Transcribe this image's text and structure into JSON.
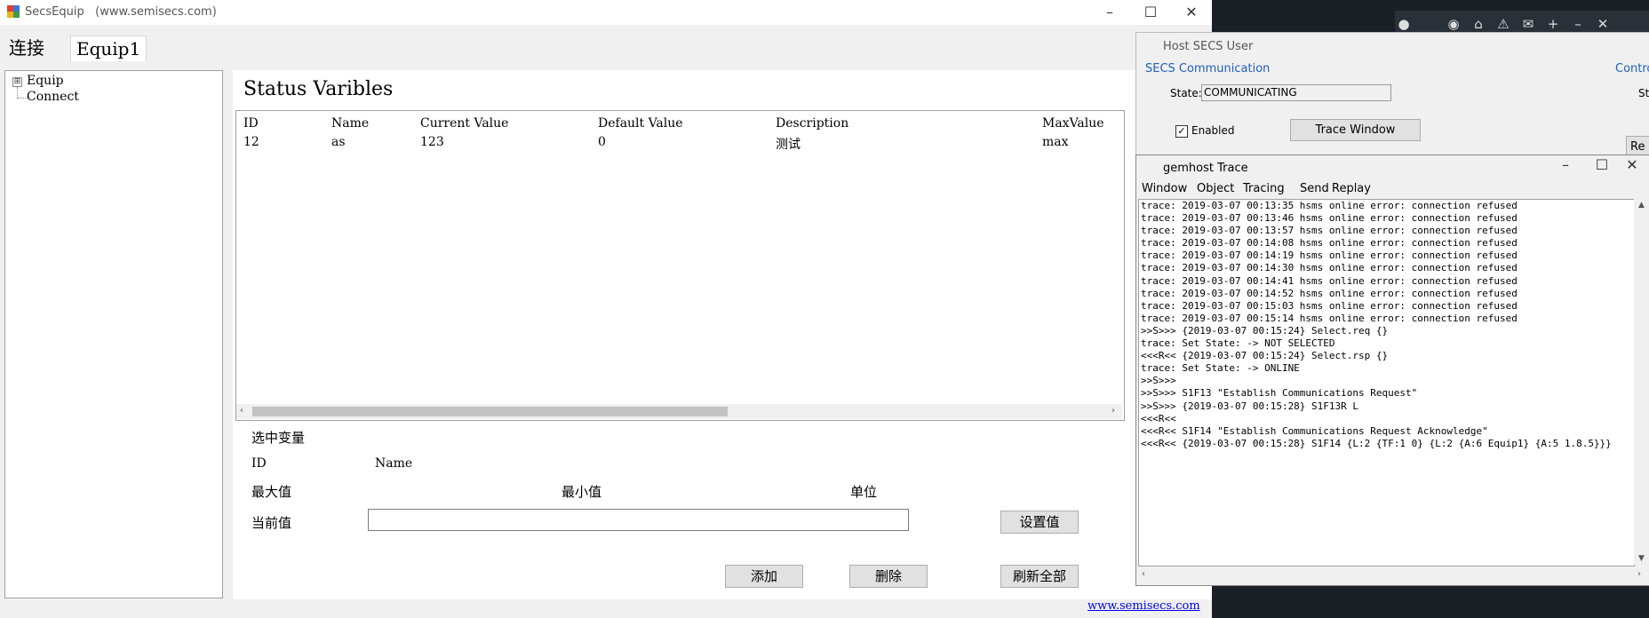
{
  "main_window": {
    "app_title": "SecsEquip",
    "website_title": "(www.semisecs.com)",
    "tabs": [
      {
        "label": "连接"
      },
      {
        "label": "Equip1"
      }
    ],
    "tree": [
      {
        "label": "Equip",
        "expander": "⊞"
      },
      {
        "label": "Connect"
      }
    ],
    "section_title": "Status Varibles",
    "grid": {
      "columns": [
        "ID",
        "Name",
        "Current Value",
        "Default Value",
        "Description",
        "MaxValue"
      ],
      "rows": [
        [
          "12",
          "as",
          "123",
          "0",
          "测试",
          "max"
        ]
      ]
    },
    "selected": {
      "heading": "选中变量",
      "id_label": "ID",
      "name_label": "Name",
      "max_label": "最大值",
      "min_label": "最小值",
      "unit_label": "单位",
      "current_label": "当前值",
      "current_value": ""
    },
    "buttons": {
      "set_value": "设置值",
      "add": "添加",
      "delete": "删除",
      "refresh_all": "刷新全部"
    },
    "footer_link": "www.semisecs.com"
  },
  "host_window": {
    "title": "Host SECS User",
    "group_communication": "SECS Communication",
    "group_control": "Contro",
    "state_label": "State:",
    "state_value": "COMMUNICATING",
    "enabled_label": "Enabled",
    "enabled_checked": "✓",
    "trace_button": "Trace Window",
    "partial_right_label": "St",
    "partial_button": "Re"
  },
  "trace_window": {
    "title": "gemhost Trace",
    "menu": [
      "Window",
      "Object",
      "Tracing",
      "Send",
      "Replay"
    ],
    "log_lines": [
      "trace: 2019-03-07 00:13:35 hsms online error: connection refused",
      "trace: 2019-03-07 00:13:46 hsms online error: connection refused",
      "trace: 2019-03-07 00:13:57 hsms online error: connection refused",
      "trace: 2019-03-07 00:14:08 hsms online error: connection refused",
      "trace: 2019-03-07 00:14:19 hsms online error: connection refused",
      "trace: 2019-03-07 00:14:30 hsms online error: connection refused",
      "trace: 2019-03-07 00:14:41 hsms online error: connection refused",
      "trace: 2019-03-07 00:14:52 hsms online error: connection refused",
      "trace: 2019-03-07 00:15:03 hsms online error: connection refused",
      "trace: 2019-03-07 00:15:14 hsms online error: connection refused",
      ">>S>>> {2019-03-07 00:15:24} Select.req {}",
      "trace: Set State: -> NOT SELECTED",
      "<<<R<< {2019-03-07 00:15:24} Select.rsp {}",
      "trace: Set State: -> ONLINE",
      ">>S>>>",
      ">>S>>> S1F13 \"Establish Communications Request\"",
      ">>S>>> {2019-03-07 00:15:28} S1F13R L",
      "<<<R<<",
      "<<<R<< S1F14 \"Establish Communications Request Acknowledge\"",
      "<<<R<< {2019-03-07 00:15:28} S1F14 {L:2 {TF:1 0} {L:2 {A:6 Equip1} {A:5 1.8.5}}}"
    ]
  }
}
